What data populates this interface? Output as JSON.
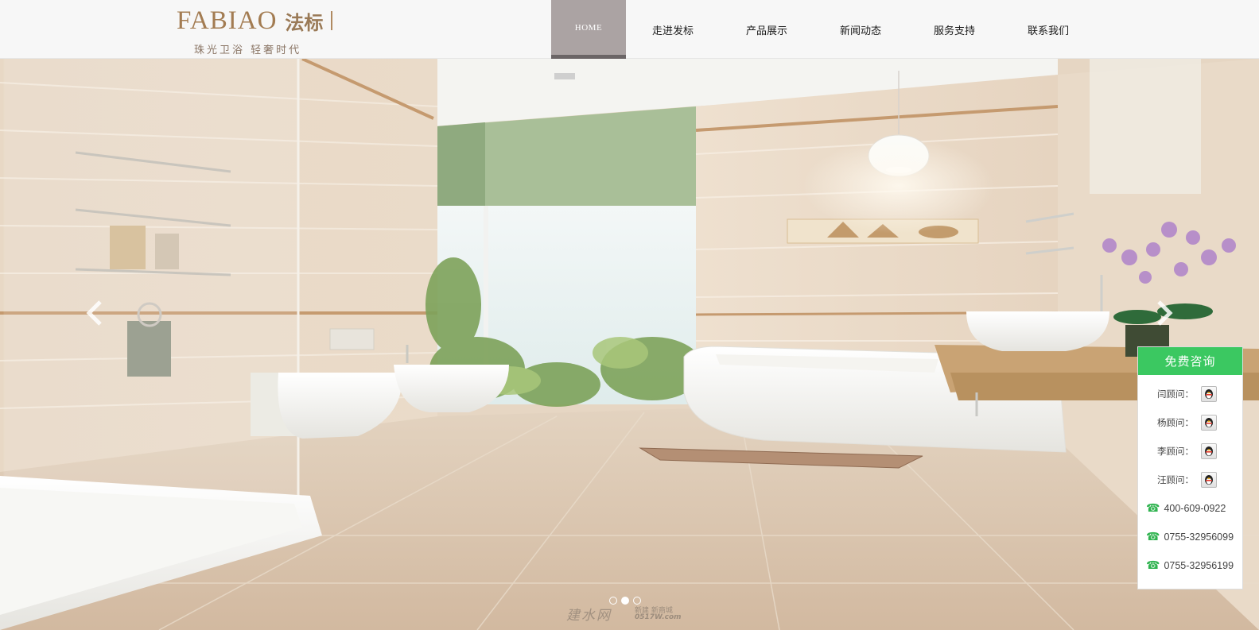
{
  "brand": {
    "wordmark": "FABIAO",
    "name_cn": "法标",
    "slogan": "珠光卫浴  轻奢时代"
  },
  "nav": {
    "items": [
      {
        "label": "HOME",
        "active": true
      },
      {
        "label": "走进发标",
        "active": false
      },
      {
        "label": "产品展示",
        "active": false
      },
      {
        "label": "新闻动态",
        "active": false
      },
      {
        "label": "服务支持",
        "active": false
      },
      {
        "label": "联系我们",
        "active": false
      }
    ]
  },
  "carousel": {
    "slide_count": 3,
    "active_slide": 2,
    "prev_icon": "chevron-left-icon",
    "next_icon": "chevron-right-icon"
  },
  "watermark": {
    "text": "建水网",
    "sub": "新建 新商城",
    "url": "0517W.com"
  },
  "consult": {
    "title": "免费咨询",
    "advisors": [
      {
        "label": "闫顾问："
      },
      {
        "label": "杨顾问："
      },
      {
        "label": "李顾问："
      },
      {
        "label": "汪顾问："
      }
    ],
    "phones": [
      "400-609-0922",
      "0755-32956099",
      "0755-32956199"
    ],
    "accent": "#3bc861"
  }
}
